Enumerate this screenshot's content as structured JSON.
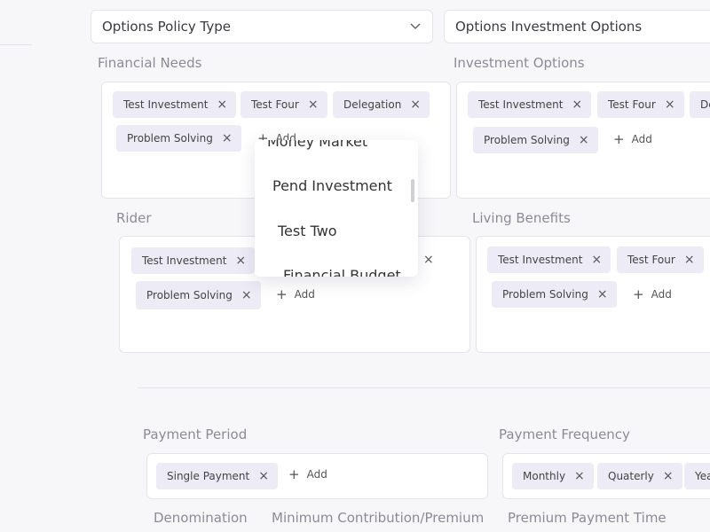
{
  "selects": {
    "policy_type": "Options Policy Type",
    "investment_options": "Options Investment Options"
  },
  "sections": {
    "financial_needs": {
      "label": "Financial Needs",
      "chips": [
        "Test Investment",
        "Test Four",
        "Delegation",
        "Problem Solving"
      ],
      "add_label": "Add"
    },
    "investment_options": {
      "label": "Investment Options",
      "chips": [
        "Test Investment",
        "Test Four",
        "De",
        "Problem Solving"
      ],
      "add_label": "Add"
    },
    "rider": {
      "label": "Rider",
      "chips": [
        "Test Investment",
        "Problem Solving"
      ],
      "add_label": "Add"
    },
    "living_benefits": {
      "label": "Living Benefits",
      "chips": [
        "Test Investment",
        "Test Four",
        "Problem Solving"
      ],
      "add_label": "Add"
    },
    "payment_period": {
      "label": "Payment Period",
      "chips": [
        "Single Payment"
      ],
      "add_label": "Add"
    },
    "payment_frequency": {
      "label": "Payment Frequency",
      "chips": [
        "Monthly",
        "Quaterly",
        "Yea"
      ]
    }
  },
  "bottom_labels": {
    "denomination": "Denomination",
    "min_contribution": "Minimum Contribution/Premium",
    "premium_payment_time": "Premium Payment Time"
  },
  "dropdown": {
    "items": [
      "Money Market",
      "Pend Investment",
      "Test Two",
      "Financial Budget"
    ]
  },
  "icons": {
    "remove": "×",
    "add": "+"
  }
}
